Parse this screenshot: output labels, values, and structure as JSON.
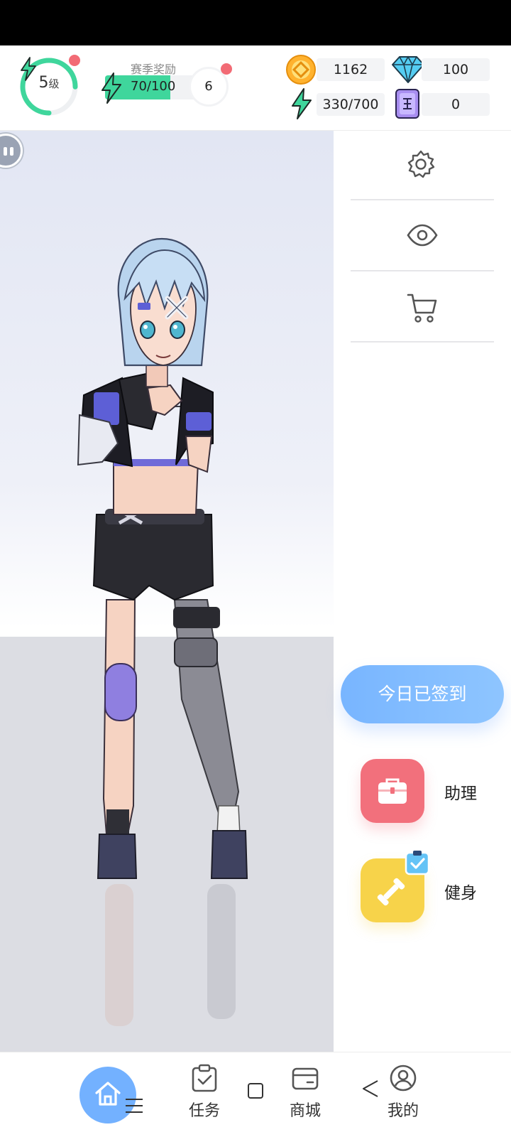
{
  "header": {
    "level": {
      "value": "5",
      "unit": "级",
      "ring_progress": 0.75,
      "ring_color": "#3fd69c"
    },
    "season": {
      "label": "赛季奖励",
      "progress_text": "70/100",
      "progress_fraction": 0.7,
      "reward_count": "6",
      "bar_color": "#3fd69c"
    },
    "currencies": {
      "coins": "1162",
      "diamonds": "100",
      "energy": "330/700",
      "tickets": "0"
    }
  },
  "side_icons": [
    "gear-icon",
    "eye-icon",
    "cart-icon"
  ],
  "signin_button": "今日已签到",
  "features": [
    {
      "label": "助理",
      "icon": "briefcase-icon",
      "color": "#f2707c"
    },
    {
      "label": "健身",
      "icon": "dumbbell-icon",
      "color": "#f7d34a"
    }
  ],
  "bottom_nav": {
    "tasks": "任务",
    "shop": "商城",
    "profile": "我的"
  },
  "colors": {
    "accent_blue": "#73b1ff",
    "notify_red": "#f26b75",
    "energy_green": "#3fd69c"
  }
}
